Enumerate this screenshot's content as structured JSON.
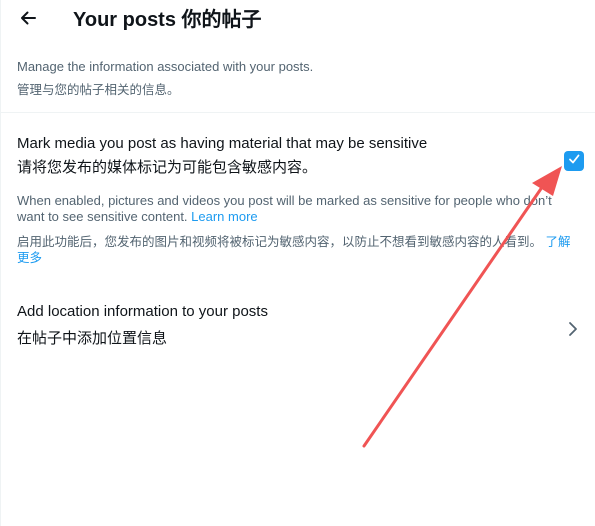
{
  "header": {
    "title": "Your posts  你的帖子",
    "back_icon": "arrow-left-icon"
  },
  "intro": {
    "en": "Manage the information associated with your posts.",
    "zh": "管理与您的帖子相关的信息。"
  },
  "sensitive": {
    "title_en": "Mark media you post as having material that may be sensitive",
    "title_zh": "请将您发布的媒体标记为可能包含敏感内容。",
    "checked": true,
    "desc_en": "When enabled, pictures and videos you post will be marked as sensitive for people who don’t want to see sensitive content. ",
    "learn_more_en": "Learn more",
    "desc_zh": "启用此功能后，您发布的图片和视频将被标记为敏感内容，以防止不想看到敏感内容的人看到。 ",
    "learn_more_zh": "了解更多"
  },
  "location": {
    "title_en": "Add location information to your posts",
    "title_zh": "在帖子中添加位置信息",
    "chevron_icon": "chevron-right-icon"
  },
  "colors": {
    "accent": "#1d9bf0",
    "annotation": "#f05454",
    "text_primary": "#0f1419",
    "text_secondary": "#536471"
  }
}
